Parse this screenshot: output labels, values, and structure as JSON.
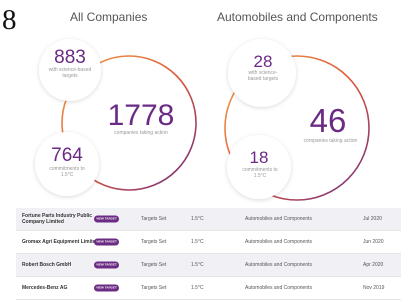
{
  "page_number": "8",
  "panels": {
    "left": {
      "title": "All Companies",
      "science_based_targets": "883",
      "science_based_targets_caption": "with science-based targets",
      "companies_taking_action": "1778",
      "companies_taking_action_caption": "companies taking action",
      "commitments": "764",
      "commitments_caption": "commitments to 1.5°C"
    },
    "right": {
      "title": "Automobiles and Components",
      "science_based_targets": "28",
      "science_based_targets_caption": "with science-based targets",
      "companies_taking_action": "46",
      "companies_taking_action_caption": "companies taking action",
      "commitments": "18",
      "commitments_caption": "commitments to 1.5°C"
    }
  },
  "colors": {
    "accent_purple": "#6b2b84",
    "ring_gradient_start": "#f0a44c",
    "ring_gradient_mid": "#e05a3a",
    "ring_gradient_end": "#6b2b84"
  },
  "table": {
    "rows": [
      {
        "company": "Fortune Parts Industry Public Company Limited",
        "button": "VIEW TARGET",
        "status": "Targets Set",
        "temperature": "1.5°C",
        "sector": "Automobiles and Components",
        "date": "Jul 2020"
      },
      {
        "company": "Gromax Agri Equipment Limited",
        "button": "VIEW TARGET",
        "status": "Targets Set",
        "temperature": "1.5°C",
        "sector": "Automobiles and Components",
        "date": "Jun 2020"
      },
      {
        "company": "Robert Bosch GmbH",
        "button": "VIEW TARGET",
        "status": "Targets Set",
        "temperature": "1.5°C",
        "sector": "Automobiles and Components",
        "date": "Apr 2020"
      },
      {
        "company": "Mercedes-Benz AG",
        "button": "VIEW TARGET",
        "status": "Targets Set",
        "temperature": "1.5°C",
        "sector": "Automobiles and Components",
        "date": "Nov 2019"
      }
    ]
  }
}
